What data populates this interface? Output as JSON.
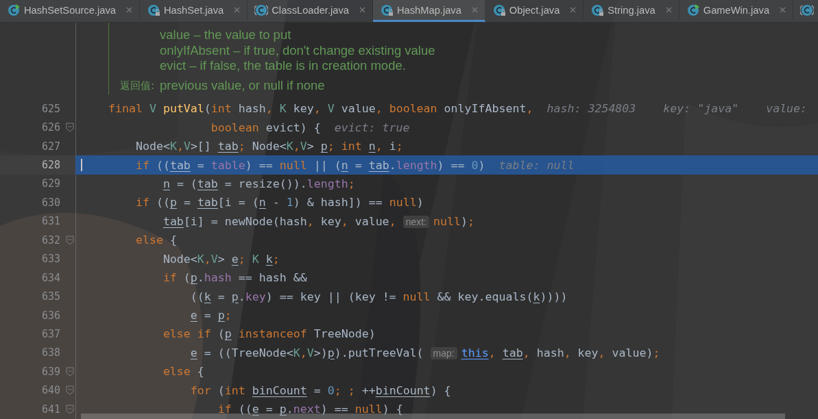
{
  "tabs": [
    {
      "label": "HashSetSource.java",
      "kind": "run",
      "selected": false
    },
    {
      "label": "HashSet.java",
      "kind": "locked",
      "selected": false
    },
    {
      "label": "ClassLoader.java",
      "kind": "abstract",
      "selected": false
    },
    {
      "label": "HashMap.java",
      "kind": "locked",
      "selected": true
    },
    {
      "label": "Object.java",
      "kind": "locked",
      "selected": false
    },
    {
      "label": "String.java",
      "kind": "locked",
      "selected": false
    },
    {
      "label": "GameWin.java",
      "kind": "run",
      "selected": false
    },
    {
      "kind": "abstract",
      "selected": false
    }
  ],
  "doc": {
    "params": [
      "value – the value to put",
      "onlyIfAbsent – if true, don't change existing value",
      "evict – if false, the table is in creation mode."
    ],
    "returns_label": "返回值:",
    "returns": "previous value, or null if none"
  },
  "lines": [
    {
      "number": "625",
      "fold": false,
      "current": false,
      "tokens": [
        {
          "t": "    final",
          "kind": "kw"
        },
        {
          "t": " V",
          "kind": "type"
        },
        {
          "t": " putVal",
          "kind": "decl"
        },
        {
          "t": "("
        },
        {
          "t": "int",
          "kind": "kw"
        },
        {
          "t": " hash"
        },
        {
          "t": ",",
          "kind": "kw"
        },
        {
          "t": " K",
          "kind": "type"
        },
        {
          "t": " key"
        },
        {
          "t": ",",
          "kind": "kw"
        },
        {
          "t": " V",
          "kind": "type"
        },
        {
          "t": " value"
        },
        {
          "t": ",",
          "kind": "kw"
        },
        {
          "t": " boolean",
          "kind": "kw"
        },
        {
          "t": " onlyIfAbsent"
        },
        {
          "t": ",",
          "kind": "kw"
        },
        {
          "t": "  hash: 3254803    key: \"java\"    value:",
          "kind": "hint"
        }
      ]
    },
    {
      "number": "626",
      "fold": true,
      "current": false,
      "tokens": [
        {
          "t": "                   boolean",
          "kind": "kw"
        },
        {
          "t": " evict) {"
        },
        {
          "t": "  evict: true",
          "kind": "hint"
        }
      ]
    },
    {
      "number": "627",
      "fold": false,
      "current": false,
      "tokens": [
        {
          "t": "        Node<"
        },
        {
          "t": "K",
          "kind": "type"
        },
        {
          "t": ",",
          "kind": "kw"
        },
        {
          "t": "V",
          "kind": "type"
        },
        {
          "t": ">[] "
        },
        {
          "t": "tab",
          "u": true
        },
        {
          "t": ";",
          "kind": "kw"
        },
        {
          "t": " Node<"
        },
        {
          "t": "K",
          "kind": "type"
        },
        {
          "t": ",",
          "kind": "kw"
        },
        {
          "t": "V",
          "kind": "type"
        },
        {
          "t": "> "
        },
        {
          "t": "p",
          "u": true
        },
        {
          "t": ";",
          "kind": "kw"
        },
        {
          "t": " int ",
          "kind": "kw"
        },
        {
          "t": "n",
          "u": true
        },
        {
          "t": ",",
          "kind": "kw"
        },
        {
          "t": " i"
        },
        {
          "t": ";",
          "kind": "kw"
        }
      ]
    },
    {
      "number": "628",
      "fold": false,
      "current": true,
      "tokens": [
        {
          "t": "        if",
          "kind": "kw"
        },
        {
          "t": " (("
        },
        {
          "t": "tab",
          "u": true
        },
        {
          "t": " = "
        },
        {
          "t": "table",
          "kind": "field"
        },
        {
          "t": ") == "
        },
        {
          "t": "null",
          "kind": "kw"
        },
        {
          "t": " || ("
        },
        {
          "t": "n",
          "u": true
        },
        {
          "t": " = "
        },
        {
          "t": "tab",
          "u": true
        },
        {
          "t": "."
        },
        {
          "t": "length",
          "kind": "field"
        },
        {
          "t": ") == "
        },
        {
          "t": "0",
          "kind": "num"
        },
        {
          "t": ")"
        },
        {
          "t": "  table: null",
          "kind": "hint"
        }
      ]
    },
    {
      "number": "629",
      "fold": false,
      "current": false,
      "tokens": [
        {
          "t": "            n",
          "u": true
        },
        {
          "t": " = ("
        },
        {
          "t": "tab",
          "u": true
        },
        {
          "t": " = resize())."
        },
        {
          "t": "length",
          "kind": "field"
        },
        {
          "t": ";",
          "kind": "kw"
        }
      ]
    },
    {
      "number": "630",
      "fold": false,
      "current": false,
      "tokens": [
        {
          "t": "        if",
          "kind": "kw"
        },
        {
          "t": " (("
        },
        {
          "t": "p",
          "u": true
        },
        {
          "t": " = "
        },
        {
          "t": "tab",
          "u": true
        },
        {
          "t": "[i = ("
        },
        {
          "t": "n",
          "u": true
        },
        {
          "t": " - "
        },
        {
          "t": "1",
          "kind": "num"
        },
        {
          "t": ") & hash]) == "
        },
        {
          "t": "null",
          "kind": "kw"
        },
        {
          "t": ")"
        }
      ]
    },
    {
      "number": "631",
      "fold": false,
      "current": false,
      "tokens": [
        {
          "t": "            tab",
          "u": true
        },
        {
          "t": "[i] = newNode(hash"
        },
        {
          "t": ",",
          "kind": "kw"
        },
        {
          "t": " key"
        },
        {
          "t": ",",
          "kind": "kw"
        },
        {
          "t": " value"
        },
        {
          "t": ",",
          "kind": "kw"
        },
        {
          "t": "next:",
          "kind": "inlay"
        },
        {
          "t": "null",
          "kind": "kw"
        },
        {
          "t": ")"
        },
        {
          "t": ";",
          "kind": "kw"
        }
      ]
    },
    {
      "number": "632",
      "fold": true,
      "current": false,
      "tokens": [
        {
          "t": "        else",
          "kind": "kw"
        },
        {
          "t": " {"
        }
      ]
    },
    {
      "number": "633",
      "fold": false,
      "current": false,
      "tokens": [
        {
          "t": "            Node<"
        },
        {
          "t": "K",
          "kind": "type"
        },
        {
          "t": ",",
          "kind": "kw"
        },
        {
          "t": "V",
          "kind": "type"
        },
        {
          "t": "> "
        },
        {
          "t": "e",
          "u": true
        },
        {
          "t": ";",
          "kind": "kw"
        },
        {
          "t": " K ",
          "kind": "type"
        },
        {
          "t": "k",
          "u": true
        },
        {
          "t": ";",
          "kind": "kw"
        }
      ]
    },
    {
      "number": "634",
      "fold": false,
      "current": false,
      "tokens": [
        {
          "t": "            if",
          "kind": "kw"
        },
        {
          "t": " ("
        },
        {
          "t": "p",
          "u": true
        },
        {
          "t": "."
        },
        {
          "t": "hash",
          "kind": "field"
        },
        {
          "t": " == hash &&"
        }
      ]
    },
    {
      "number": "635",
      "fold": false,
      "current": false,
      "tokens": [
        {
          "t": "                (("
        },
        {
          "t": "k",
          "u": true
        },
        {
          "t": " = "
        },
        {
          "t": "p",
          "u": true
        },
        {
          "t": "."
        },
        {
          "t": "key",
          "kind": "field"
        },
        {
          "t": ") == key || (key != "
        },
        {
          "t": "null",
          "kind": "kw"
        },
        {
          "t": " && key.equals("
        },
        {
          "t": "k",
          "u": true
        },
        {
          "t": "))))"
        }
      ]
    },
    {
      "number": "636",
      "fold": false,
      "current": false,
      "tokens": [
        {
          "t": "                e",
          "u": true
        },
        {
          "t": " = "
        },
        {
          "t": "p",
          "u": true
        },
        {
          "t": ";",
          "kind": "kw"
        }
      ]
    },
    {
      "number": "637",
      "fold": false,
      "current": false,
      "tokens": [
        {
          "t": "            else if",
          "kind": "kw"
        },
        {
          "t": " ("
        },
        {
          "t": "p",
          "u": true
        },
        {
          "t": " instanceof",
          "kind": "kw"
        },
        {
          "t": " TreeNode)"
        }
      ]
    },
    {
      "number": "638",
      "fold": false,
      "current": false,
      "tokens": [
        {
          "t": "                e",
          "u": true
        },
        {
          "t": " = ((TreeNode<"
        },
        {
          "t": "K",
          "kind": "type"
        },
        {
          "t": ",",
          "kind": "kw"
        },
        {
          "t": "V",
          "kind": "type"
        },
        {
          "t": ">)"
        },
        {
          "t": "p",
          "u": true
        },
        {
          "t": ").putTreeVal("
        },
        {
          "t": "map:",
          "kind": "inlay"
        },
        {
          "t": "this",
          "kind": "link"
        },
        {
          "t": ",",
          "kind": "kw"
        },
        {
          "t": " tab",
          "u": true
        },
        {
          "t": ",",
          "kind": "kw"
        },
        {
          "t": " hash"
        },
        {
          "t": ",",
          "kind": "kw"
        },
        {
          "t": " key"
        },
        {
          "t": ",",
          "kind": "kw"
        },
        {
          "t": " value)"
        },
        {
          "t": ";",
          "kind": "kw"
        }
      ]
    },
    {
      "number": "639",
      "fold": true,
      "current": false,
      "tokens": [
        {
          "t": "            else",
          "kind": "kw"
        },
        {
          "t": " {"
        }
      ]
    },
    {
      "number": "640",
      "fold": true,
      "current": false,
      "tokens": [
        {
          "t": "                for",
          "kind": "kw"
        },
        {
          "t": " ("
        },
        {
          "t": "int",
          "kind": "kw"
        },
        {
          "t": " binCount",
          "u": true
        },
        {
          "t": " = "
        },
        {
          "t": "0",
          "kind": "num"
        },
        {
          "t": ";",
          "kind": "kw"
        },
        {
          "t": " ;",
          "kind": "kw"
        },
        {
          "t": " ++"
        },
        {
          "t": "binCount",
          "u": true
        },
        {
          "t": ") {"
        }
      ]
    },
    {
      "number": "641",
      "fold": true,
      "current": false,
      "tokens": [
        {
          "t": "                    if",
          "kind": "kw"
        },
        {
          "t": " (("
        },
        {
          "t": "e",
          "u": true
        },
        {
          "t": " = "
        },
        {
          "t": "p",
          "u": true
        },
        {
          "t": "."
        },
        {
          "t": "next",
          "kind": "field"
        },
        {
          "t": ") == "
        },
        {
          "t": "null",
          "kind": "kw"
        },
        {
          "t": ") {"
        }
      ]
    }
  ]
}
